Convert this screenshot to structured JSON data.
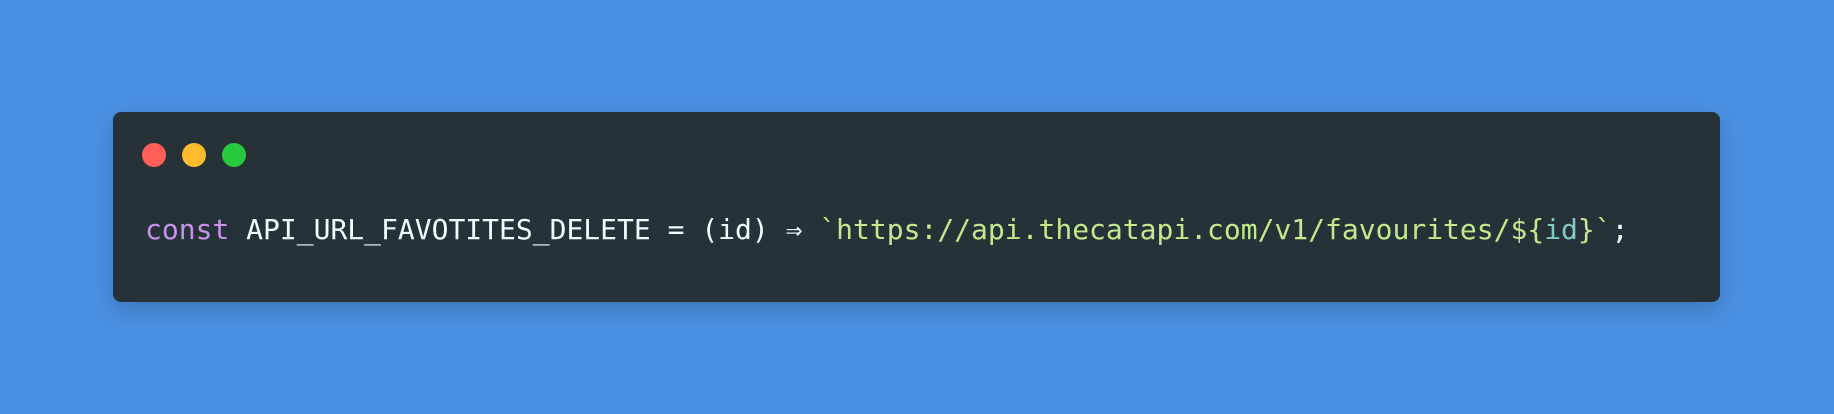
{
  "window": {
    "controls": [
      {
        "name": "close",
        "color": "#ff5f56"
      },
      {
        "name": "minimize",
        "color": "#ffbd2e"
      },
      {
        "name": "maximize",
        "color": "#27c93f"
      }
    ]
  },
  "code": {
    "keyword": "const",
    "space1": " ",
    "identifier": "API_URL_FAVOTITES_DELETE",
    "assign": " = ",
    "params": "(id)",
    "arrow": " ⇒ ",
    "tpl_open": "`https://api.thecatapi.com/v1/favourites/",
    "interp_open": "${",
    "interp_var": "id",
    "interp_close": "}",
    "tpl_close": "`",
    "semicolon": ";"
  },
  "colors": {
    "background": "#4a90e2",
    "editor": "#263238",
    "keyword": "#c792ea",
    "text": "#eeffff",
    "string": "#c3e88d",
    "interpolation": "#89ddff",
    "variable": "#80cbc4"
  }
}
